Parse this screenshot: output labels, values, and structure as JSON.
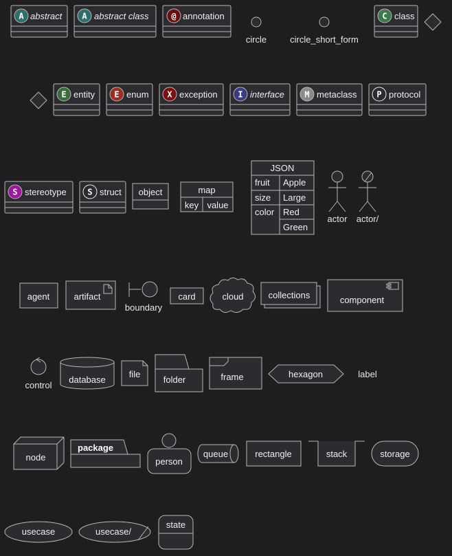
{
  "classifiers": {
    "abstract": {
      "glyph": "A",
      "label": "abstract"
    },
    "abstract_class": {
      "glyph": "A",
      "label": "abstract class"
    },
    "annotation": {
      "glyph": "@",
      "label": "annotation"
    },
    "class": {
      "glyph": "C",
      "label": "class"
    },
    "entity": {
      "glyph": "E",
      "label": "entity"
    },
    "enum": {
      "glyph": "E",
      "label": "enum"
    },
    "exception": {
      "glyph": "X",
      "label": "exception"
    },
    "interface": {
      "glyph": "I",
      "label": "interface"
    },
    "metaclass": {
      "glyph": "M",
      "label": "metaclass"
    },
    "protocol": {
      "glyph": "P",
      "label": "protocol"
    },
    "stereotype": {
      "glyph": "S",
      "label": "stereotype"
    },
    "struct": {
      "glyph": "S",
      "label": "struct"
    }
  },
  "circles": {
    "circle": "circle",
    "circle_short_form": "circle_short_form"
  },
  "object": {
    "label": "object"
  },
  "map": {
    "title": "map",
    "key": "key",
    "value": "value"
  },
  "json": {
    "title": "JSON",
    "rows": [
      {
        "key": "fruit",
        "values": [
          "Apple"
        ]
      },
      {
        "key": "size",
        "values": [
          "Large"
        ]
      },
      {
        "key": "color",
        "values": [
          "Red",
          "Green"
        ]
      }
    ]
  },
  "actors": {
    "actor": "actor",
    "actor_business": "actor/"
  },
  "elements": {
    "agent": "agent",
    "artifact": "artifact",
    "boundary": "boundary",
    "card": "card",
    "cloud": "cloud",
    "collections": "collections",
    "component": "component",
    "control": "control",
    "database": "database",
    "file": "file",
    "folder": "folder",
    "frame": "frame",
    "hexagon": "hexagon",
    "label": "label",
    "node": "node",
    "package": "package",
    "person": "person",
    "queue": "queue",
    "rectangle": "rectangle",
    "stack": "stack",
    "storage": "storage",
    "usecase": "usecase",
    "usecase_business": "usecase/",
    "state": "state"
  },
  "colors": {
    "background": "#1e1e1e",
    "shape_fill": "#2b2b30",
    "border": "#b8b8b8",
    "text": "#f0f0f0",
    "abstract": "#2f6f6b",
    "annotation": "#6a0f0f",
    "class": "#3e7a4a",
    "entity": "#3a6b3a",
    "enum": "#9b3020",
    "exception": "#7a1010",
    "interface": "#3a3d80",
    "metaclass": "#8a8a8a",
    "protocol": "#2b2b30",
    "stereotype": "#9b1a9b",
    "struct": "#2b2b30"
  }
}
